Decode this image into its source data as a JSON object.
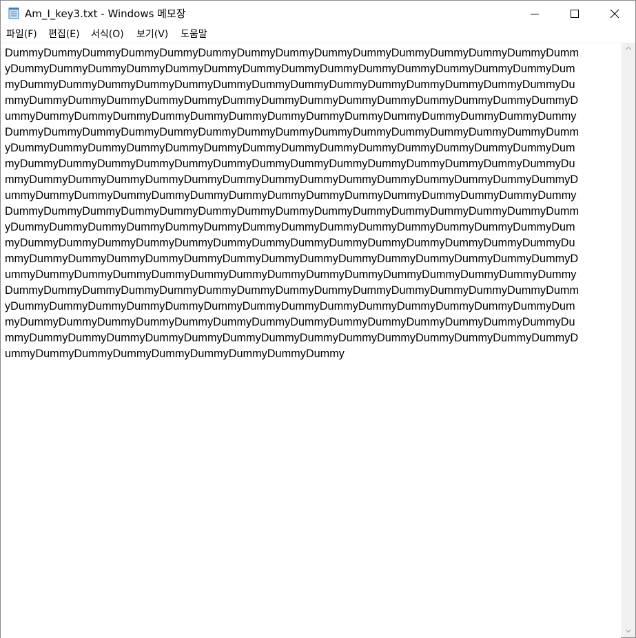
{
  "window": {
    "title": "Am_I_key3.txt - Windows 메모장",
    "app_icon": "notepad-icon",
    "controls": [
      "minimize-icon",
      "maximize-icon",
      "close-icon"
    ]
  },
  "menu": {
    "file": "파일(F)",
    "edit": "편집(E)",
    "format": "서식(O)",
    "view": "보기(V)",
    "help": "도움말"
  },
  "editor": {
    "lines": [
      "DummyDummyDummyDummyDummyDummyDummyDummyDummyDummyDummyDummyDummyDummyDumm",
      "yDummyDummyDummyDummyDummyDummyDummyDummyDummyDummyDummyDummyDummyDummyDum",
      "myDummyDummyDummyDummyDummyDummyDummyDummyDummyDummyDummyDummyDummyDummyDu",
      "mmyDummyDummyDummyDummyDummyDummyDummyDummyDummyDummyDummyDummyDummyDummyD",
      "ummyDummyDummyDummyDummyDummyDummyDummyDummyDummyDummyDummyDummyDummyDummy",
      "DummyDummyDummyDummyDummyDummyDummyDummyDummyDummyDummyDummyDummyDummyDumm",
      "yDummyDummyDummyDummyDummyDummyDummyDummyDummyDummyDummyDummyDummyDummyDum",
      "myDummyDummyDummyDummyDummyDummyDummyDummyDummyDummyDummyDummyDummyDummyDu",
      "mmyDummyDummyDummyDummyDummyDummyDummyDummyDummyDummyDummyDummyDummyDummyD",
      "ummyDummyDummyDummyDummyDummyDummyDummyDummyDummyDummyDummyDummyDummyDummy",
      "DummyDummyDummyDummyDummyDummyDummyDummyDummyDummyDummyDummyDummyDummyDumm",
      "yDummyDummyDummyDummyDummyDummyDummyDummyDummyDummyDummyDummyDummyDummyDum",
      "myDummyDummyDummyDummyDummyDummyDummyDummyDummyDummyDummyDummyDummyDummyDu",
      "mmyDummyDummyDummyDummyDummyDummyDummyDummyDummyDummyDummyDummyDummyDummyD",
      "ummyDummyDummyDummyDummyDummyDummyDummyDummyDummyDummyDummyDummyDummyDummy",
      "DummyDummyDummyDummyDummyDummyDummyDummyDummyDummyDummyDummyDummyDummyDumm",
      "yDummyDummyDummyDummyDummyDummyDummyDummyDummyDummyDummyDummyDummyDummyDum",
      "myDummyDummyDummyDummyDummyDummyDummyDummyDummyDummyDummyDummyDummyDummyDu",
      "mmyDummyDummyDummyDummyDummyDummyDummyDummyDummyDummyDummyDummyDummyDummyD",
      "ummyDummyDummyDummyDummyDummyDummyDummyDummy"
    ]
  },
  "scrollbar": {
    "up_icon": "scroll-up-arrow-icon",
    "down_icon": "scroll-down-arrow-icon"
  },
  "colors": {
    "scrollbar_track": "#f0f0f0",
    "window_border": "#8a8a8a",
    "text": "#000000"
  }
}
